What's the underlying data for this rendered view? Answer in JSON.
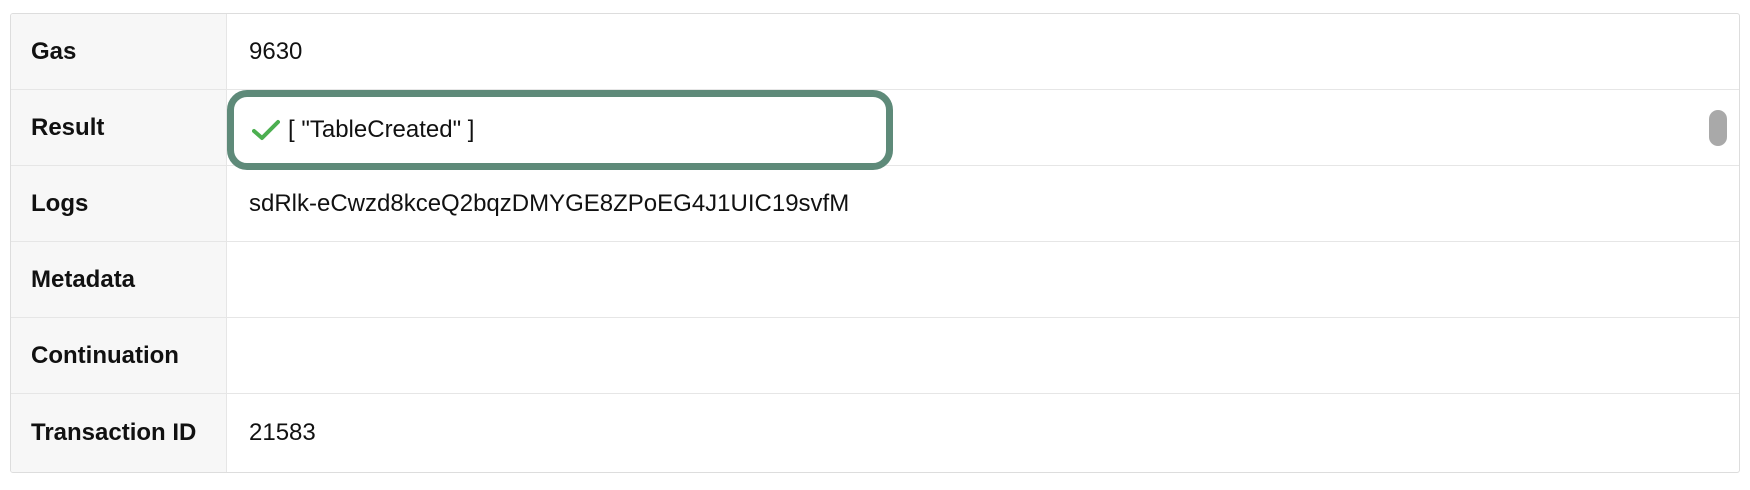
{
  "rows": [
    {
      "label": "Gas",
      "value": "9630"
    },
    {
      "label": "Result",
      "value": "[ \"TableCreated\" ]"
    },
    {
      "label": "Logs",
      "value": "sdRlk-eCwzd8kceQ2bqzDMYGE8ZPoEG4J1UIC19svfM"
    },
    {
      "label": "Metadata",
      "value": ""
    },
    {
      "label": "Continuation",
      "value": ""
    },
    {
      "label": "Transaction ID",
      "value": "21583"
    }
  ],
  "icons": {
    "result_status": "check-icon"
  },
  "colors": {
    "highlight_border": "#5e8a79",
    "check": "#4caf50"
  }
}
